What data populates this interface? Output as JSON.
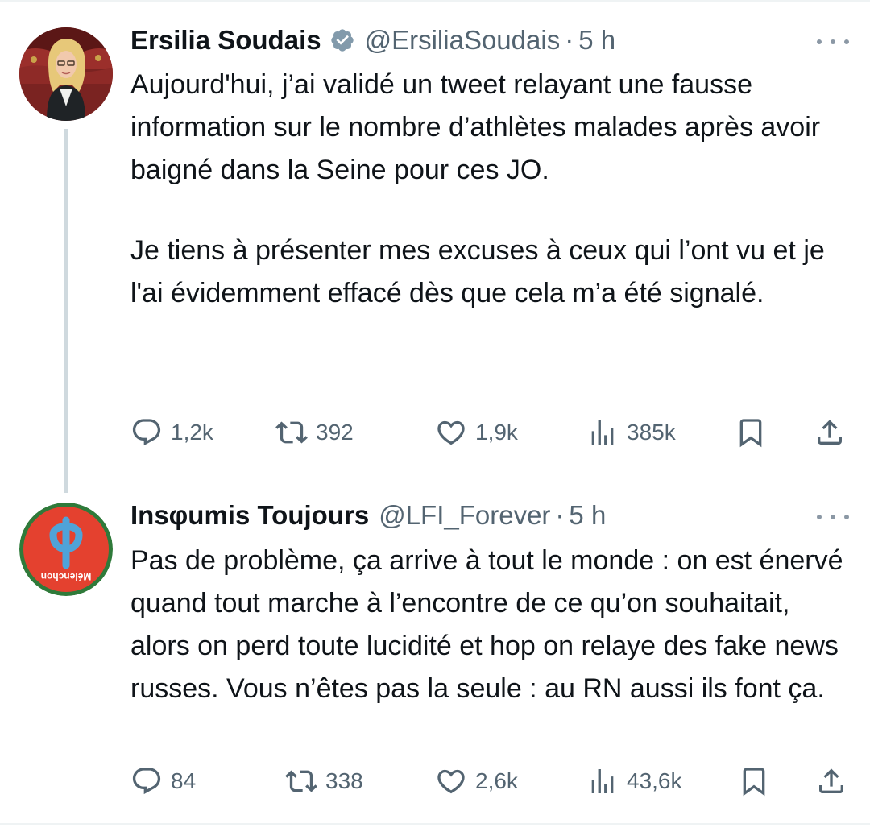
{
  "tweets": [
    {
      "name": "Ersilia Soudais",
      "handle": "@ErsiliaSoudais",
      "separator": "·",
      "time": "5 h",
      "verified": true,
      "paragraphs": [
        "Aujourd'hui, j’ai validé un tweet relayant une fausse information sur le nombre d’athlètes malades après avoir baigné dans la Seine pour ces JO.",
        "Je tiens à présenter mes excuses à ceux qui l’ont vu et je l'ai évidemment effacé dès que cela m’a été signalé."
      ],
      "stats": {
        "replies": "1,2k",
        "reposts": "392",
        "likes": "1,9k",
        "views": "385k"
      }
    },
    {
      "name": "Insφumis Toujours",
      "handle": "@LFI_Forever",
      "separator": "·",
      "time": "5 h",
      "verified": false,
      "avatar_text": "Mélenchon",
      "paragraphs": [
        "Pas de problème, ça arrive à tout le monde : on est énervé quand tout marche à l’encontre de ce qu’on souhaitait, alors on perd toute lucidité et hop on relaye des fake news russes. Vous n’êtes pas la seule : au RN aussi ils font ça."
      ],
      "stats": {
        "replies": "84",
        "reposts": "338",
        "likes": "2,6k",
        "views": "43,6k"
      }
    }
  ],
  "icons": {
    "reply": "reply-icon",
    "repost": "repost-icon",
    "like": "like-icon",
    "views": "views-icon",
    "bookmark": "bookmark-icon",
    "share": "share-icon",
    "more": "more-icon",
    "verified": "verified-badge-icon"
  },
  "colors": {
    "text": "#0f1419",
    "secondary": "#536471",
    "divider": "#cfd9de",
    "verified_badge": "#829aab",
    "lfi_red": "#e4412f",
    "lfi_phi": "#4fa3d9"
  }
}
